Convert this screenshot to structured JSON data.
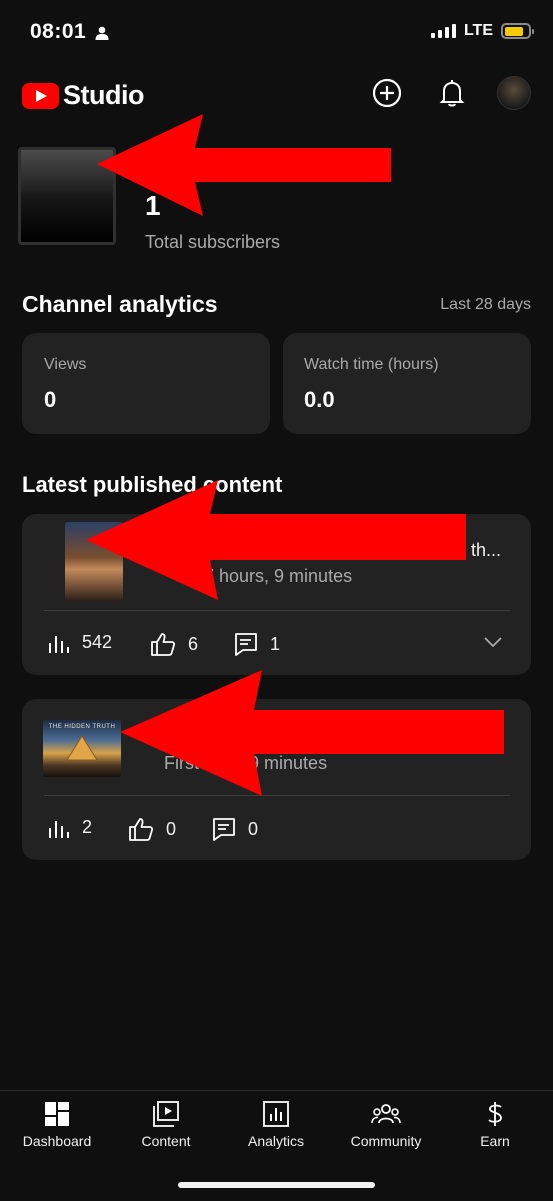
{
  "status_bar": {
    "time": "08:01",
    "network": "LTE",
    "icons": [
      "person-icon",
      "signal-icon",
      "battery-icon"
    ],
    "battery_color": "#f5cc00"
  },
  "header": {
    "logo_text": "Studio",
    "brand_color": "#ff0000",
    "icons": [
      "create-plus-icon",
      "notifications-bell-icon",
      "channel-avatar"
    ]
  },
  "channel": {
    "subscriber_count": "1",
    "subscriber_label": "Total subscribers"
  },
  "analytics": {
    "title": "Channel analytics",
    "range": "Last 28 days",
    "cards": [
      {
        "label": "Views",
        "value": "0"
      },
      {
        "label": "Watch time (hours)",
        "value": "0.0"
      }
    ]
  },
  "latest": {
    "title": "Latest published content",
    "items": [
      {
        "title": "th...",
        "subtitle": "7 hours, 9 minutes",
        "views": "542",
        "likes": "6",
        "comments": "1"
      },
      {
        "thumb_caption": "THE HIDDEN TRUTH",
        "title": "",
        "subtitle_prefix": "First",
        "subtitle": "ours, 9 minutes",
        "views": "2",
        "likes": "0",
        "comments": "0"
      }
    ]
  },
  "annotation_color": "#ff0000",
  "bottom_nav": [
    {
      "label": "Dashboard",
      "icon": "dashboard-icon"
    },
    {
      "label": "Content",
      "icon": "content-icon"
    },
    {
      "label": "Analytics",
      "icon": "analytics-icon"
    },
    {
      "label": "Community",
      "icon": "community-icon"
    },
    {
      "label": "Earn",
      "icon": "earn-dollar-icon"
    }
  ]
}
